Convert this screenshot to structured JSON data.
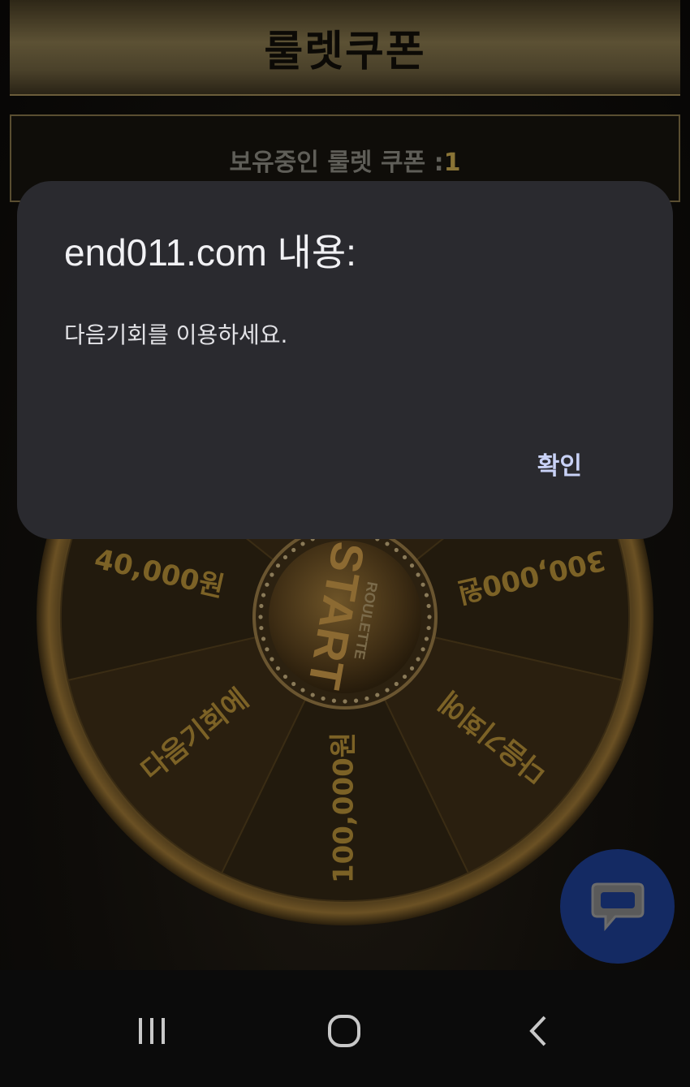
{
  "header": {
    "title": "룰렛쿠폰"
  },
  "coupon": {
    "label": "보유중인 룰렛 쿠폰 :",
    "count": "1"
  },
  "wheel": {
    "center_top": "ROULETTE",
    "center_main": "START",
    "segments": [
      "다음기회에",
      "300,000원",
      "다음기회에",
      "100,000원",
      "다음기회에",
      "40,000원",
      "다음기회에"
    ]
  },
  "dialog": {
    "title": "end011.com 내용:",
    "message": "다음기회를 이용하세요.",
    "ok_label": "확인"
  },
  "colors": {
    "accent_gold": "#8a7436",
    "dialog_bg": "#2a2a2f",
    "chat_button": "#142a63"
  },
  "icons": {
    "chat": "chat-bubble-icon",
    "recents": "recents-icon",
    "home": "home-icon",
    "back": "back-icon"
  }
}
